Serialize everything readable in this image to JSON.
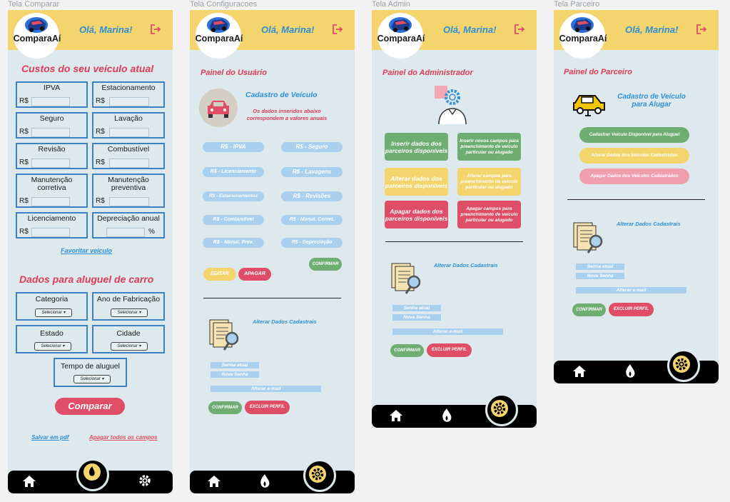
{
  "frames": {
    "comparar": "Tela Comparar",
    "config": "Tela Configuracoes",
    "admin": "Tela Admin",
    "parceiro": "Tela Parceiro"
  },
  "header": {
    "logo": "ComparaAí",
    "greeting": "Olá, Marina!"
  },
  "colors": {
    "header": "#f3d46d",
    "background": "#dde9ec",
    "accent_red": "#dc3b59",
    "accent_blue": "#2d8fd8",
    "green": "#6fae72"
  },
  "comparar": {
    "title": "Custos do seu veículo atual",
    "currency": "R$",
    "fields": {
      "ipva": "IPVA",
      "estacionamento": "Estacionamento",
      "seguro": "Seguro",
      "lavacao": "Lavação",
      "revisao": "Revisão",
      "combustivel": "Combustível",
      "manut_corretiva_1": "Manutenção",
      "manut_corretiva_2": "corretiva",
      "manut_preventiva_1": "Manutenção",
      "manut_preventiva_2": "preventiva",
      "licenciamento": "Licenciamento",
      "depreciacao": "Depreciação anual",
      "percent": "%"
    },
    "favoritar": "Favoritar veículo",
    "aluguel_title": "Dados para aluguel de carro",
    "aluguel": {
      "categoria": "Categoria",
      "ano": "Ano de  Fabricação",
      "estado": "Estado",
      "cidade": "Cidade",
      "tempo": "Tempo de aluguel",
      "selecionar": "Selecionar ▾"
    },
    "comparar_btn": "Comparar",
    "salvar_pdf": "Salvar  em pdf",
    "apagar": "Apagar todos os campos"
  },
  "config": {
    "title": "Painel do Usuário",
    "cadastro": "Cadastro de Veículo",
    "nota": "Os dados inseridos abaixo correspondem a valores anuais",
    "pills": [
      "R$ - IPVA",
      "R$ - Seguro",
      "R$ - Licenciamento",
      "R$ - Lavagens",
      "R$ - Estacionamentos",
      "R$ - Revisões",
      "R$ - Combustível",
      "R$ - Manut. Corret.",
      "R$ - Manut. Prev.",
      "R$ - Depreciação"
    ],
    "confirmar": "CONFIRMAR",
    "editar": "EDITAR",
    "apagar": "APAGAR",
    "alterar": "Alterar Dados Cadastrais",
    "senha_atual": "Senha atual",
    "nova_senha": "Nova Senha",
    "alterar_email": "Alterar e-mail",
    "excluir": "EXCLUIR PERFIL"
  },
  "admin": {
    "title": "Painel do Administrador",
    "inserir": "Inserir dados dos parceiros disponíveis",
    "inserir_campos": "Inserir novos campos para preenchimento de veículo particular ou alugado",
    "alterar": "Alterar dados dos parceiros disponíveis",
    "alterar_campos": "Alterar campos para preenchimento de veículo particular ou alugado",
    "apagar": "Apagar dados dos parceiros disponíveis",
    "apagar_campos": "Apagar campos para preenchimento de veículo particular ou alugado",
    "alterar_cad": "Alterar Dados Cadastrais",
    "senha_atual": "Senha atual",
    "nova_senha": "Nova Senha",
    "alterar_email": "Alterar e-mail",
    "confirmar": "CONFIRMAR",
    "excluir": "EXCLUIR PERFIL"
  },
  "parceiro": {
    "title": "Painel do Parceiro",
    "cadastro": "Cadastro de Veículo para Alugar",
    "btn1": "Cadastrar Veículo Disponível para Aluguel",
    "btn2": "Alterar Dados dos Veículos Cadastrados",
    "btn3": "Apagar Dados dos Veículos Cadastrados",
    "alterar_cad": "Alterar Dados Cadastrais",
    "senha_atual": "Senha atual",
    "nova_senha": "Nova Senha",
    "alterar_email": "Alterar e-mail",
    "confirmar": "CONFIRMAR",
    "excluir": "EXCLUIR PERFIL"
  }
}
